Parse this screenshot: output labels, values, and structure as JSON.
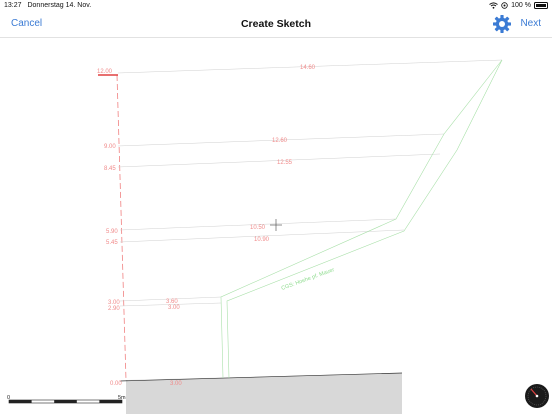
{
  "status_bar": {
    "time": "13:27",
    "date": "Donnerstag 14. Nov.",
    "battery": "100 %",
    "icons": [
      "wifi-icon",
      "location-icon",
      "battery-icon"
    ]
  },
  "nav": {
    "cancel_label": "Cancel",
    "title": "Create Sketch",
    "next_label": "Next",
    "settings_icon": "gear-icon"
  },
  "sketch": {
    "height_labels": [
      "12.00",
      "9.00",
      "8.45",
      "5.90",
      "5.45",
      "3.00",
      "2.90",
      "0.00"
    ],
    "width_labels": [
      "14.60",
      "12.60",
      "12.55",
      "10.50",
      "10.90",
      "3.60",
      "3.00",
      "3.00"
    ],
    "slope_label": "CGS: Hoehe pf. Mauer",
    "scale_start": "0",
    "scale_end": "5m",
    "colors": {
      "dimension": "#f08a8a",
      "section": "#8fdc8f",
      "ground": "#d8d8d8",
      "accent": "#3b7bd4"
    }
  }
}
